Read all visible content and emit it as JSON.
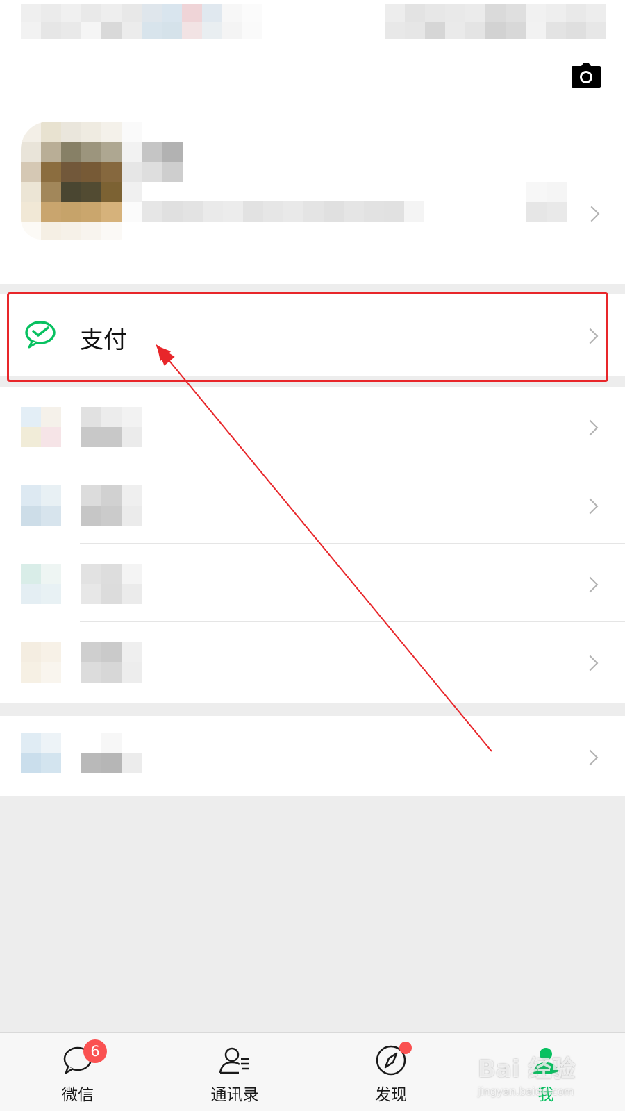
{
  "profile": {
    "camera_icon": "camera-icon"
  },
  "pay": {
    "label": "支付",
    "icon": "wechat-pay-icon"
  },
  "list_rows": [
    {
      "icon": "blurred-icon"
    },
    {
      "icon": "blurred-icon"
    },
    {
      "icon": "blurred-icon"
    },
    {
      "icon": "blurred-icon"
    }
  ],
  "settings_row": {
    "icon": "blurred-icon"
  },
  "tabbar": {
    "tabs": [
      {
        "label": "微信",
        "icon": "chat-bubble-icon",
        "badge": "6"
      },
      {
        "label": "通讯录",
        "icon": "contacts-icon"
      },
      {
        "label": "发现",
        "icon": "compass-icon",
        "dot": true
      },
      {
        "label": "我",
        "icon": "person-icon",
        "active": true
      }
    ]
  },
  "watermark": {
    "brand": "Bai 经验",
    "url": "jingyan.baidu.com"
  },
  "colors": {
    "accent_green": "#07c160",
    "highlight_red": "#e8262a",
    "badge_red": "#fa5151",
    "background": "#ededed"
  }
}
